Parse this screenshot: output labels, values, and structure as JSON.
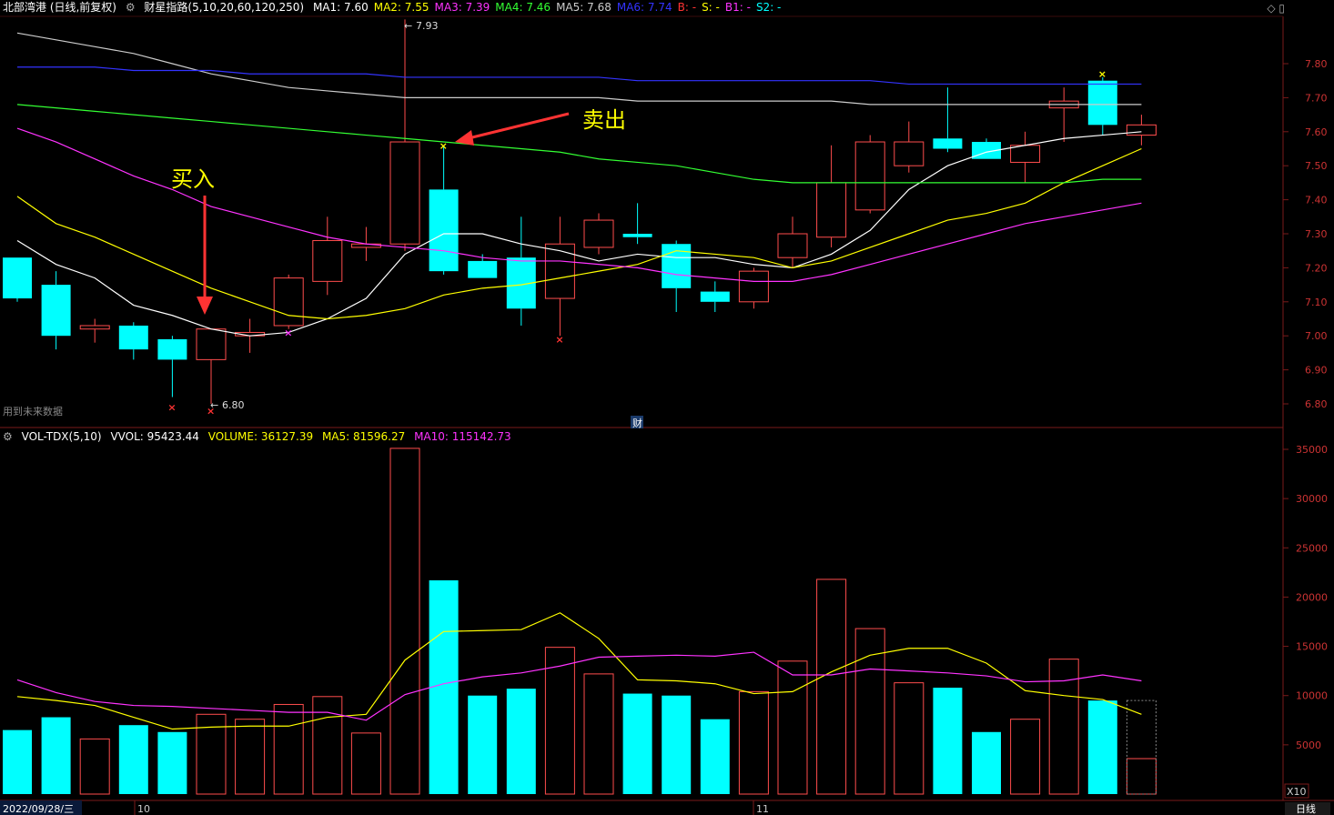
{
  "header": {
    "title": "北部湾港 (日线,前复权)",
    "indicator": "财星指路(5,10,20,60,120,250)",
    "ma": [
      {
        "label": "MA1: 7.60",
        "color": "#ffffff"
      },
      {
        "label": "MA2: 7.55",
        "color": "#ffff00"
      },
      {
        "label": "MA3: 7.39",
        "color": "#ff33ff"
      },
      {
        "label": "MA4: 7.46",
        "color": "#33ff33"
      },
      {
        "label": "MA5: 7.68",
        "color": "#cccccc"
      },
      {
        "label": "MA6: 7.74",
        "color": "#3333ff"
      },
      {
        "label": "B: -",
        "color": "#ff3333"
      },
      {
        "label": "S: -",
        "color": "#ffff00"
      },
      {
        "label": "B1: -",
        "color": "#ff33ff"
      },
      {
        "label": "S2: -",
        "color": "#00ffff"
      }
    ]
  },
  "vol_header": {
    "name": "VOL-TDX(5,10)",
    "vvol": "VVOL: 95423.44",
    "volume": "VOLUME: 36127.39",
    "ma5": "MA5: 81596.27",
    "ma10": "MA10: 115142.73"
  },
  "annotations": {
    "buy": "买入",
    "sell": "卖出",
    "future_data": "用到未来数据",
    "high_label": "7.93",
    "low_label": "6.80",
    "cai": "财"
  },
  "footer": {
    "date": "2022/09/28/三",
    "month_oct": "10",
    "month_nov": "11",
    "period": "日线",
    "x10": "X10"
  },
  "colors": {
    "up": "#ff4d4d",
    "down": "#00ffff",
    "ma1": "#ffffff",
    "ma2": "#ffff00",
    "ma3": "#ff33ff",
    "ma4": "#33ff33",
    "ma5": "#cccccc",
    "ma6": "#3333ff"
  },
  "chart_data": [
    {
      "type": "candlestick",
      "title": "北部湾港 (日线,前复权)",
      "y_ticks": [
        6.8,
        6.9,
        7.0,
        7.1,
        7.2,
        7.3,
        7.4,
        7.5,
        7.6,
        7.7,
        7.8
      ],
      "ylim": [
        6.77,
        7.98
      ],
      "candles": [
        {
          "o": 7.23,
          "h": 7.23,
          "l": 7.1,
          "c": 7.11
        },
        {
          "o": 7.15,
          "h": 7.19,
          "l": 6.96,
          "c": 7.0
        },
        {
          "o": 7.02,
          "h": 7.05,
          "l": 6.98,
          "c": 7.03
        },
        {
          "o": 7.03,
          "h": 7.04,
          "l": 6.93,
          "c": 6.96
        },
        {
          "o": 6.99,
          "h": 7.0,
          "l": 6.82,
          "c": 6.93
        },
        {
          "o": 6.93,
          "h": 7.02,
          "l": 6.8,
          "c": 7.02
        },
        {
          "o": 7.0,
          "h": 7.05,
          "l": 6.95,
          "c": 7.01
        },
        {
          "o": 7.03,
          "h": 7.18,
          "l": 7.02,
          "c": 7.17
        },
        {
          "o": 7.16,
          "h": 7.35,
          "l": 7.12,
          "c": 7.28
        },
        {
          "o": 7.26,
          "h": 7.32,
          "l": 7.22,
          "c": 7.27
        },
        {
          "o": 7.27,
          "h": 7.93,
          "l": 7.25,
          "c": 7.57
        },
        {
          "o": 7.43,
          "h": 7.56,
          "l": 7.18,
          "c": 7.19
        },
        {
          "o": 7.22,
          "h": 7.24,
          "l": 7.17,
          "c": 7.17
        },
        {
          "o": 7.23,
          "h": 7.35,
          "l": 7.03,
          "c": 7.08
        },
        {
          "o": 7.11,
          "h": 7.35,
          "l": 7.0,
          "c": 7.27
        },
        {
          "o": 7.26,
          "h": 7.36,
          "l": 7.24,
          "c": 7.34
        },
        {
          "o": 7.3,
          "h": 7.39,
          "l": 7.27,
          "c": 7.29
        },
        {
          "o": 7.27,
          "h": 7.28,
          "l": 7.07,
          "c": 7.14
        },
        {
          "o": 7.13,
          "h": 7.16,
          "l": 7.07,
          "c": 7.1
        },
        {
          "o": 7.1,
          "h": 7.2,
          "l": 7.08,
          "c": 7.19
        },
        {
          "o": 7.23,
          "h": 7.35,
          "l": 7.2,
          "c": 7.3
        },
        {
          "o": 7.29,
          "h": 7.56,
          "l": 7.26,
          "c": 7.45
        },
        {
          "o": 7.37,
          "h": 7.59,
          "l": 7.36,
          "c": 7.57
        },
        {
          "o": 7.5,
          "h": 7.63,
          "l": 7.48,
          "c": 7.57
        },
        {
          "o": 7.58,
          "h": 7.73,
          "l": 7.54,
          "c": 7.55
        },
        {
          "o": 7.57,
          "h": 7.58,
          "l": 7.52,
          "c": 7.52
        },
        {
          "o": 7.51,
          "h": 7.6,
          "l": 7.45,
          "c": 7.56
        },
        {
          "o": 7.67,
          "h": 7.73,
          "l": 7.57,
          "c": 7.69
        },
        {
          "o": 7.75,
          "h": 7.76,
          "l": 7.59,
          "c": 7.62
        },
        {
          "o": 7.59,
          "h": 7.65,
          "l": 7.56,
          "c": 7.62
        }
      ],
      "series": [
        {
          "name": "MA1",
          "values": [
            7.28,
            7.21,
            7.17,
            7.09,
            7.06,
            7.02,
            7.0,
            7.01,
            7.05,
            7.11,
            7.24,
            7.3,
            7.3,
            7.27,
            7.25,
            7.22,
            7.24,
            7.23,
            7.23,
            7.21,
            7.2,
            7.24,
            7.31,
            7.43,
            7.5,
            7.54,
            7.56,
            7.58,
            7.59,
            7.6
          ]
        },
        {
          "name": "MA2",
          "values": [
            7.41,
            7.33,
            7.29,
            7.24,
            7.19,
            7.14,
            7.1,
            7.06,
            7.05,
            7.06,
            7.08,
            7.12,
            7.14,
            7.15,
            7.17,
            7.19,
            7.21,
            7.25,
            7.24,
            7.23,
            7.2,
            7.22,
            7.26,
            7.3,
            7.34,
            7.36,
            7.39,
            7.45,
            7.5,
            7.55
          ]
        },
        {
          "name": "MA3",
          "values": [
            7.61,
            7.57,
            7.52,
            7.47,
            7.43,
            7.38,
            7.35,
            7.32,
            7.29,
            7.27,
            7.26,
            7.25,
            7.23,
            7.22,
            7.22,
            7.21,
            7.2,
            7.18,
            7.17,
            7.16,
            7.16,
            7.18,
            7.21,
            7.24,
            7.27,
            7.3,
            7.33,
            7.35,
            7.37,
            7.39
          ]
        },
        {
          "name": "MA4",
          "values": [
            7.68,
            7.67,
            7.66,
            7.65,
            7.64,
            7.63,
            7.62,
            7.61,
            7.6,
            7.59,
            7.58,
            7.57,
            7.56,
            7.55,
            7.54,
            7.52,
            7.51,
            7.5,
            7.48,
            7.46,
            7.45,
            7.45,
            7.45,
            7.45,
            7.45,
            7.45,
            7.45,
            7.45,
            7.46,
            7.46
          ]
        },
        {
          "name": "MA5",
          "values": [
            7.89,
            7.87,
            7.85,
            7.83,
            7.8,
            7.77,
            7.75,
            7.73,
            7.72,
            7.71,
            7.7,
            7.7,
            7.7,
            7.7,
            7.7,
            7.7,
            7.69,
            7.69,
            7.69,
            7.69,
            7.69,
            7.69,
            7.68,
            7.68,
            7.68,
            7.68,
            7.68,
            7.68,
            7.68,
            7.68
          ]
        },
        {
          "name": "MA6",
          "values": [
            7.79,
            7.79,
            7.79,
            7.78,
            7.78,
            7.78,
            7.77,
            7.77,
            7.77,
            7.77,
            7.76,
            7.76,
            7.76,
            7.76,
            7.76,
            7.76,
            7.75,
            7.75,
            7.75,
            7.75,
            7.75,
            7.75,
            7.75,
            7.74,
            7.74,
            7.74,
            7.74,
            7.74,
            7.74,
            7.74
          ]
        }
      ],
      "markers": [
        {
          "index": 4,
          "price": 6.79,
          "type": "B"
        },
        {
          "index": 5,
          "price": 6.78,
          "type": "B"
        },
        {
          "index": 7,
          "price": 7.01,
          "type": "B1"
        },
        {
          "index": 11,
          "price": 7.56,
          "type": "S"
        },
        {
          "index": 14,
          "price": 6.99,
          "type": "B"
        },
        {
          "index": 28,
          "price": 7.77,
          "type": "S"
        }
      ]
    },
    {
      "type": "bar",
      "title": "VOL-TDX(5,10)",
      "y_ticks": [
        5000,
        10000,
        15000,
        20000,
        25000,
        30000,
        35000
      ],
      "ylim": [
        0,
        36000
      ],
      "series": [
        {
          "name": "VOLUME",
          "values": [
            6500,
            7800,
            5600,
            7000,
            6300,
            8100,
            7600,
            9100,
            9900,
            6200,
            35100,
            21700,
            10000,
            10700,
            14900,
            12200,
            10200,
            10000,
            7600,
            10400,
            13500,
            21800,
            16800,
            11300,
            10800,
            6300,
            7600,
            13700,
            9500,
            3600
          ]
        },
        {
          "name": "MA5",
          "values": [
            9900,
            9500,
            9000,
            7800,
            6600,
            6800,
            6900,
            6900,
            7800,
            8100,
            13600,
            16500,
            16600,
            16700,
            18400,
            15800,
            11600,
            11500,
            11200,
            10200,
            10400,
            12400,
            14100,
            14800,
            14800,
            13300,
            10500,
            10000,
            9600,
            8100
          ]
        },
        {
          "name": "MA10",
          "values": [
            11600,
            10300,
            9400,
            9000,
            8900,
            8700,
            8500,
            8300,
            8300,
            7500,
            10100,
            11200,
            11900,
            12300,
            13000,
            13900,
            14000,
            14100,
            14000,
            14400,
            12100,
            12100,
            12700,
            12500,
            12300,
            12000,
            11400,
            11500,
            12100,
            11500
          ]
        }
      ]
    }
  ]
}
